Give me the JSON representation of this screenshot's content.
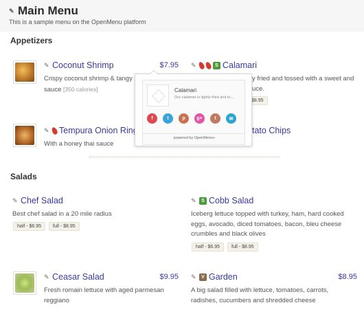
{
  "header": {
    "title": "Main Menu",
    "subtitle": "This is a sample menu on the OpenMenu platform"
  },
  "sections": {
    "appetizers": {
      "title": "Appetizers"
    },
    "salads": {
      "title": "Salads"
    }
  },
  "items": {
    "coconut_shrimp": {
      "name": "Coconut Shrimp",
      "price": "$7.95",
      "desc_line1": "Crispy coconut shrimp & tangy",
      "desc_line2": "sauce",
      "calories": "[350 calories]"
    },
    "calamari": {
      "name": "Calamari",
      "badge": "S",
      "desc_line1": "y fried and tossed with a sweet and",
      "desc_line2": "uce.",
      "size_partial": "$8.95"
    },
    "tempura": {
      "name": "Tempura Onion Rings",
      "desc": "With a honey thai sauce"
    },
    "potato_chips": {
      "name": "tato Chips"
    },
    "chef_salad": {
      "name": "Chef Salad",
      "desc": "Best chef salad in a 20 mile radius",
      "sizes": [
        "half - $6.95",
        "full - $8.95"
      ]
    },
    "cobb_salad": {
      "name": "Cobb Salad",
      "badge": "S",
      "desc_lines": [
        "Iceberg lettuce topped with turkey, ham, hard cooked",
        "eggs, avocado, diced tomatoes, bacon, bleu cheese",
        "crumbles and black olives"
      ],
      "sizes": [
        "half - $6.95",
        "full - $8.95"
      ]
    },
    "ceasar_salad": {
      "name": "Ceasar Salad",
      "price": "$9.95",
      "desc_line1": "Fresh romain lettuce with aged parmesan",
      "desc_line2": "reggiano"
    },
    "garden": {
      "name": "Garden",
      "badge": "V",
      "price": "$8.95",
      "desc_line1": "A big salad filled with lettuce, tomatoes, carrots,",
      "desc_line2": "radishes, cucumbers and shredded cheese"
    }
  },
  "popup": {
    "name": "Calamari",
    "desc": "Our calamari is lightly fried and to...",
    "social": [
      {
        "icon": "facebook-icon",
        "glyph": "f",
        "color": "#e0484f"
      },
      {
        "icon": "twitter-icon",
        "glyph": "t",
        "color": "#3aa6d8"
      },
      {
        "icon": "pinterest-icon",
        "glyph": "p",
        "color": "#c9724f"
      },
      {
        "icon": "googleplus-icon",
        "glyph": "g+",
        "color": "#e254a6"
      },
      {
        "icon": "tumblr-icon",
        "glyph": "t",
        "color": "#c17a62"
      },
      {
        "icon": "email-icon",
        "glyph": "✉",
        "color": "#2fa3cf"
      }
    ],
    "powered_by": "powered by OpenMenu+"
  },
  "colors": {
    "link": "#3a3a9e",
    "pepper": "#d63b2f",
    "badge_s": "#4c9a3c",
    "badge_v": "#8a6a4e"
  }
}
